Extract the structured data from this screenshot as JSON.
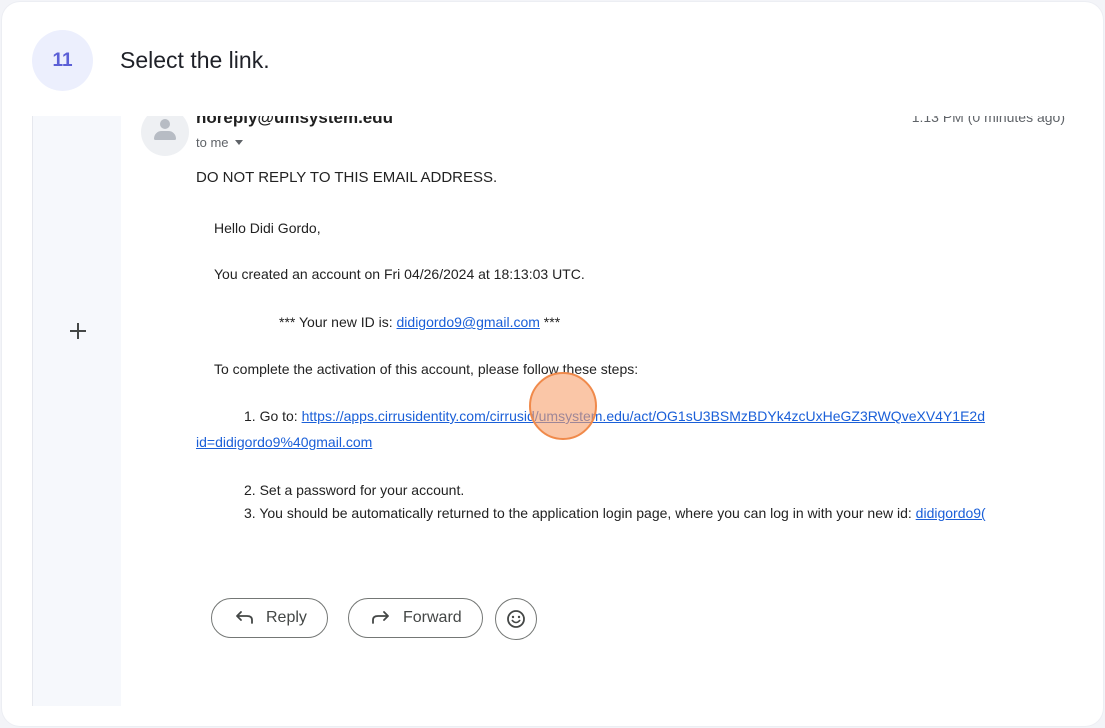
{
  "step": {
    "number": "11",
    "instruction": "Select the link."
  },
  "email": {
    "sender": "noreply@umsystem.edu",
    "time": "1:13 PM (0 minutes ago)",
    "recipient": "to me",
    "lines": {
      "warning": "DO NOT REPLY TO THIS EMAIL ADDRESS.",
      "greeting": "Hello Didi Gordo,",
      "created": "You created an account on Fri 04/26/2024 at 18:13:03 UTC.",
      "id_prefix": "*** Your new ID is: ",
      "id_link": "didigordo9@gmail.com",
      "id_suffix": " ***",
      "steps_intro": "To complete the activation of this account, please follow these steps:",
      "step1_prefix": "1. Go to: ",
      "step1_link": "https://apps.cirrusidentity.com/cirrusid/umsystem.edu/act/OG1sU3BSMzBDYk4zcUxHeGZ3RWQveXV4Y1E2d",
      "step1_link_cont": "id=didigordo9%40gmail.com",
      "step2": "2. Set a password for your account.",
      "step3_prefix": "3. You should be automatically returned to the application login page, where you can log in with your new id: ",
      "step3_link": "didigordo9("
    }
  },
  "actions": {
    "reply": "Reply",
    "forward": "Forward"
  },
  "colors": {
    "accent": "#5b5fd6",
    "link": "#1a5fd8",
    "click_marker": "#f08a4b"
  }
}
